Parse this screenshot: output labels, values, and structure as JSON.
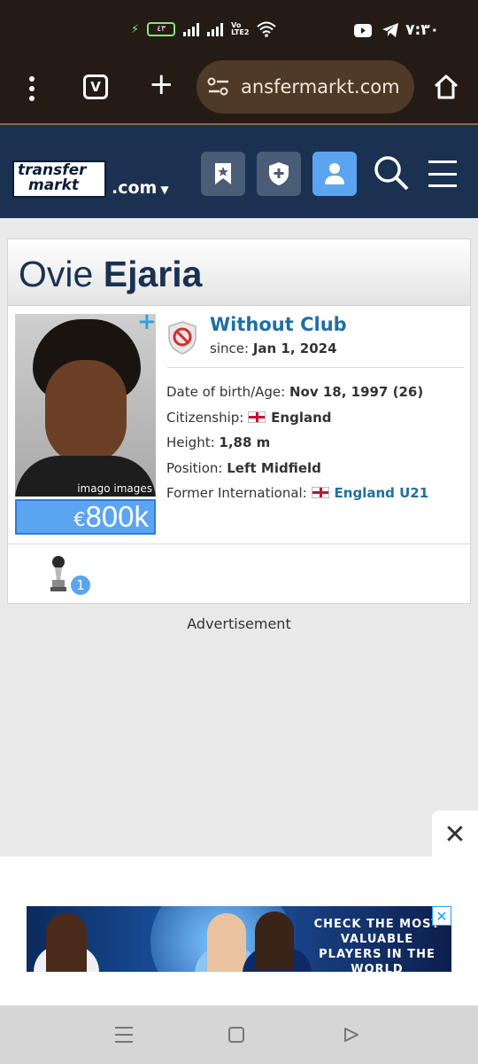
{
  "status_bar": {
    "time": "٧:٣٠",
    "battery": "٤٣",
    "volte": "Vo LTE2"
  },
  "browser": {
    "tabs_label": "V",
    "url": "ansfermarkt.com"
  },
  "site": {
    "logo_line1": "transfer",
    "logo_line2": "markt",
    "domain": ".com",
    "icons": [
      "watchlist-icon",
      "shield-plus-icon",
      "user-icon",
      "search-icon",
      "hamburger-icon"
    ]
  },
  "player": {
    "first_name": "Ovie",
    "last_name": "Ejaria",
    "photo_credit": "imago images",
    "market_value_currency": "€",
    "market_value": "800k",
    "club": "Without Club",
    "since_label": "since:",
    "since_value": "Jan 1, 2024",
    "facts": [
      {
        "label": "Date of birth/Age:",
        "value": "Nov 18, 1997 (26)"
      },
      {
        "label": "Citizenship:",
        "value": "England"
      },
      {
        "label": "Height:",
        "value": "1,88 m"
      },
      {
        "label": "Position:",
        "value": "Left Midfield"
      },
      {
        "label": "Former International:",
        "value": "England U21"
      }
    ],
    "trophy_count": "1"
  },
  "advertisement_label": "Advertisement",
  "ad": {
    "headline": "CHECK THE MOST VALUABLE PLAYERS IN THE WORLD",
    "close": "✕",
    "ad_x": "✕"
  },
  "colors": {
    "header_bg": "#1a3151",
    "link": "#1f6fa3",
    "value_bg": "#5ba4f0",
    "browser_bg": "#241b14"
  }
}
